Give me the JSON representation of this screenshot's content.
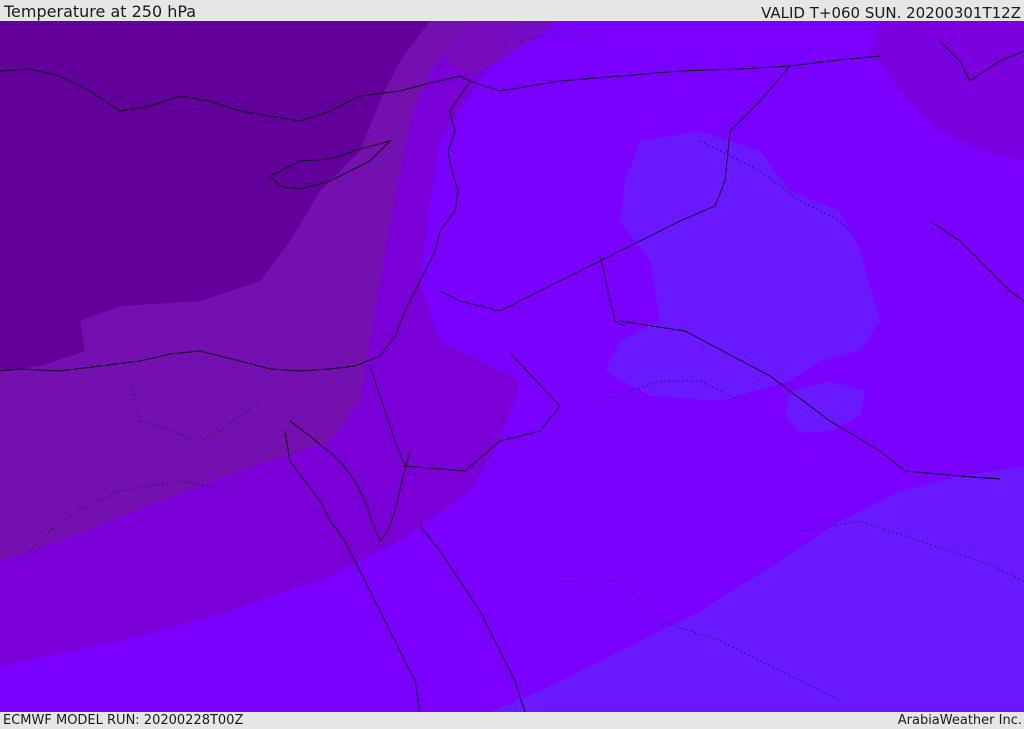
{
  "header": {
    "title": "Temperature at 250 hPa",
    "valid_time": "VALID T+060 SUN. 20200301T12Z"
  },
  "footer": {
    "model_run": "ECMWF MODEL RUN: 20200228T00Z",
    "credit": "ArabiaWeather Inc."
  },
  "colors": {
    "band_coldest": "#63009b",
    "band_cold": "#7510b0",
    "band_mid": "#7b00d8",
    "band_base": "#7a00ff",
    "band_warm": "#6a18ff",
    "border": "#0a0a14"
  }
}
